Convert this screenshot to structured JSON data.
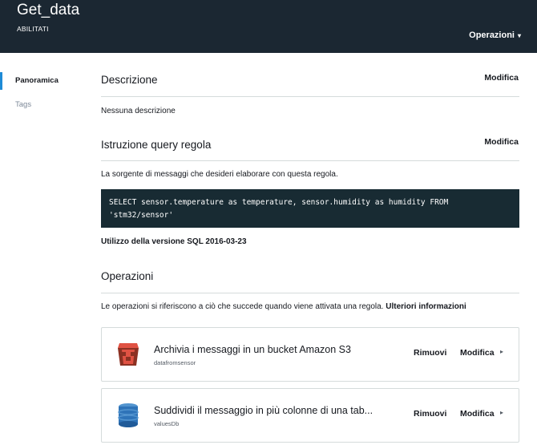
{
  "header": {
    "title": "Get_data",
    "status": "ABILITATI",
    "operations_label": "Operazioni",
    "operations_caret": "▾"
  },
  "sidebar": {
    "items": [
      {
        "label": "Panoramica",
        "active": true
      },
      {
        "label": "Tags",
        "active": false
      }
    ]
  },
  "main": {
    "description": {
      "title": "Descrizione",
      "edit_label": "Modifica",
      "text": "Nessuna descrizione"
    },
    "query": {
      "title": "Istruzione query regola",
      "edit_label": "Modifica",
      "intro": "La sorgente di messaggi che desideri elaborare con questa regola.",
      "sql": "SELECT sensor.temperature as temperature, sensor.humidity as humidity FROM\n'stm32/sensor'",
      "sql_version": "Utilizzo della versione SQL 2016-03-23"
    },
    "actions": {
      "title": "Operazioni",
      "intro": "Le operazioni si riferiscono a ciò che succede quando viene attivata una regola.",
      "more_link": "Ulteriori informazioni",
      "items": [
        {
          "name": "Archivia i messaggi in un bucket Amazon S3",
          "detail": "datafromsensor",
          "icon": "s3-bucket-icon",
          "remove": "Rimuovi",
          "modify": "Modifica",
          "arrow": "▸"
        },
        {
          "name": "Suddividi il messaggio in più colonne di una tab...",
          "detail": "valuesDb",
          "icon": "dynamodb-icon",
          "remove": "Rimuovi",
          "modify": "Modifica",
          "arrow": "▸"
        }
      ]
    }
  },
  "colors": {
    "header_bg": "#1b2732",
    "accent": "#1e8bd6",
    "code_bg": "#182b33",
    "s3_red": "#c7352c",
    "dynamodb_blue": "#2f6fb7"
  }
}
